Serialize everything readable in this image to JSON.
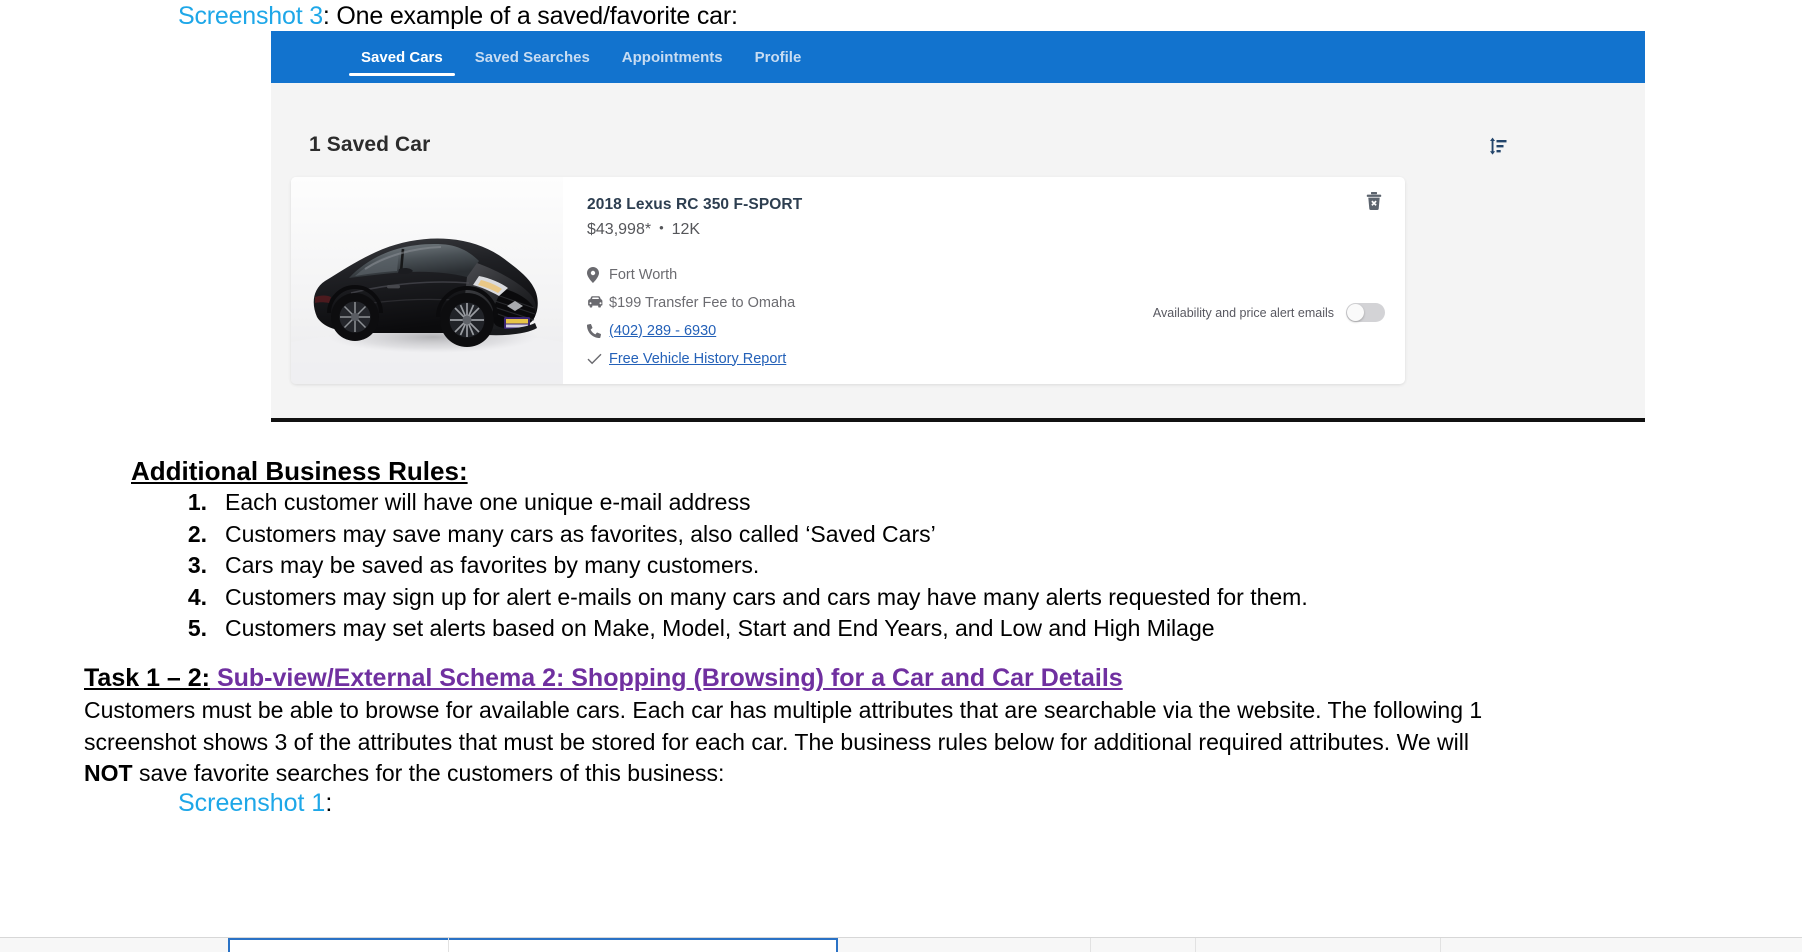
{
  "document": {
    "screenshot3_caption_label": "Screenshot 3",
    "screenshot3_caption_rest": ": One example of a saved/favorite car:",
    "screenshot1_caption_label": "Screenshot 1",
    "screenshot1_caption_rest": ":",
    "business_rules_heading": "Additional Business Rules:",
    "business_rules": [
      {
        "num": "1.",
        "text": "Each customer will have one unique e-mail address"
      },
      {
        "num": "2.",
        "text": "Customers may save many cars as favorites, also called ‘Saved Cars’"
      },
      {
        "num": "3.",
        "text": "Cars may be saved as favorites by many customers."
      },
      {
        "num": "4.",
        "text": "Customers may sign up for alert e-mails on many cars and cars may have many alerts requested for them."
      },
      {
        "num": "5.",
        "text": "Customers may set alerts based on Make, Model, Start and End Years, and Low and High Milage"
      }
    ],
    "task_heading_black": "Task 1 – 2:",
    "task_heading_purple": " Sub-view/External Schema 2:  Shopping (Browsing) for a Car and Car Details",
    "paragraph_part1": "Customers must be able to browse for available cars. Each car has multiple attributes that are searchable via the website. The following 1 screenshot shows 3 of the attributes that must be stored for each car. The business rules below for additional required attributes. We will ",
    "paragraph_bold": "NOT",
    "paragraph_part2": " save favorite searches for the customers of this business:"
  },
  "app": {
    "nav": {
      "items": [
        {
          "label": "Saved Cars",
          "active": true
        },
        {
          "label": "Saved Searches",
          "active": false
        },
        {
          "label": "Appointments",
          "active": false
        },
        {
          "label": "Profile",
          "active": false
        }
      ],
      "background_color": "#1273CE"
    },
    "saved_cars": {
      "count_heading": "1 Saved Car",
      "sort_icon": "sort-icon",
      "card": {
        "photo_alt": "black 2018 Lexus RC 350 F-SPORT coupe",
        "title": "2018 Lexus RC 350 F-SPORT",
        "price": "$43,998*",
        "separator": "•",
        "mileage": "12K",
        "specs": [
          {
            "icon": "location-pin-icon",
            "text": "Fort Worth",
            "link": false
          },
          {
            "icon": "car-front-icon",
            "text": "$199 Transfer Fee to Omaha",
            "link": false
          },
          {
            "icon": "phone-icon",
            "text": "(402) 289 - 6930",
            "link": true
          },
          {
            "icon": "check-icon",
            "text": "Free Vehicle History Report",
            "link": true
          }
        ],
        "alert_label": "Availability and price alert emails",
        "alert_toggle_on": false,
        "delete_icon": "trash-icon"
      }
    }
  },
  "colors": {
    "brand_blue": "#1273CE",
    "caption_cyan": "#1EA7E8",
    "link_blue": "#2461B8",
    "heading_purple": "#7030A0",
    "page_grey": "#F4F4F4"
  }
}
